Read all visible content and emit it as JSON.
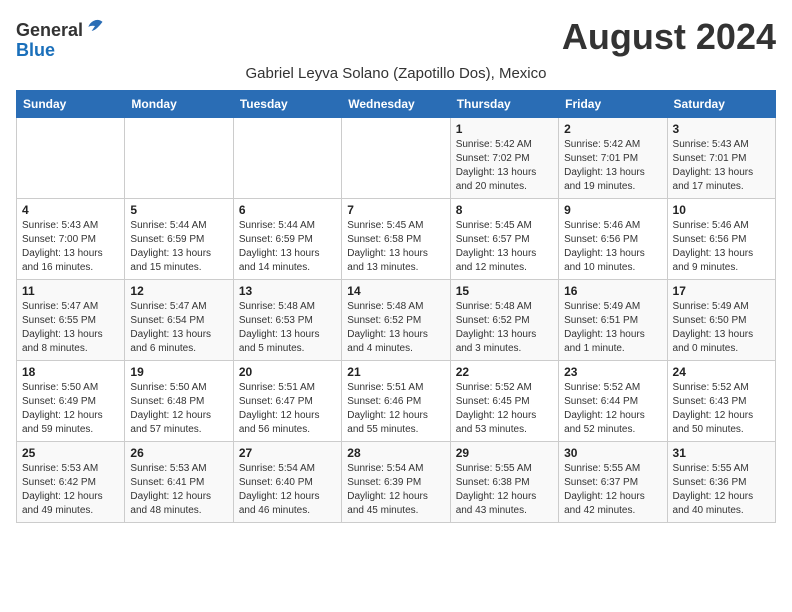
{
  "header": {
    "logo_general": "General",
    "logo_blue": "Blue",
    "month_title": "August 2024",
    "subtitle": "Gabriel Leyva Solano (Zapotillo Dos), Mexico"
  },
  "weekdays": [
    "Sunday",
    "Monday",
    "Tuesday",
    "Wednesday",
    "Thursday",
    "Friday",
    "Saturday"
  ],
  "weeks": [
    [
      {
        "day": "",
        "info": ""
      },
      {
        "day": "",
        "info": ""
      },
      {
        "day": "",
        "info": ""
      },
      {
        "day": "",
        "info": ""
      },
      {
        "day": "1",
        "info": "Sunrise: 5:42 AM\nSunset: 7:02 PM\nDaylight: 13 hours\nand 20 minutes."
      },
      {
        "day": "2",
        "info": "Sunrise: 5:42 AM\nSunset: 7:01 PM\nDaylight: 13 hours\nand 19 minutes."
      },
      {
        "day": "3",
        "info": "Sunrise: 5:43 AM\nSunset: 7:01 PM\nDaylight: 13 hours\nand 17 minutes."
      }
    ],
    [
      {
        "day": "4",
        "info": "Sunrise: 5:43 AM\nSunset: 7:00 PM\nDaylight: 13 hours\nand 16 minutes."
      },
      {
        "day": "5",
        "info": "Sunrise: 5:44 AM\nSunset: 6:59 PM\nDaylight: 13 hours\nand 15 minutes."
      },
      {
        "day": "6",
        "info": "Sunrise: 5:44 AM\nSunset: 6:59 PM\nDaylight: 13 hours\nand 14 minutes."
      },
      {
        "day": "7",
        "info": "Sunrise: 5:45 AM\nSunset: 6:58 PM\nDaylight: 13 hours\nand 13 minutes."
      },
      {
        "day": "8",
        "info": "Sunrise: 5:45 AM\nSunset: 6:57 PM\nDaylight: 13 hours\nand 12 minutes."
      },
      {
        "day": "9",
        "info": "Sunrise: 5:46 AM\nSunset: 6:56 PM\nDaylight: 13 hours\nand 10 minutes."
      },
      {
        "day": "10",
        "info": "Sunrise: 5:46 AM\nSunset: 6:56 PM\nDaylight: 13 hours\nand 9 minutes."
      }
    ],
    [
      {
        "day": "11",
        "info": "Sunrise: 5:47 AM\nSunset: 6:55 PM\nDaylight: 13 hours\nand 8 minutes."
      },
      {
        "day": "12",
        "info": "Sunrise: 5:47 AM\nSunset: 6:54 PM\nDaylight: 13 hours\nand 6 minutes."
      },
      {
        "day": "13",
        "info": "Sunrise: 5:48 AM\nSunset: 6:53 PM\nDaylight: 13 hours\nand 5 minutes."
      },
      {
        "day": "14",
        "info": "Sunrise: 5:48 AM\nSunset: 6:52 PM\nDaylight: 13 hours\nand 4 minutes."
      },
      {
        "day": "15",
        "info": "Sunrise: 5:48 AM\nSunset: 6:52 PM\nDaylight: 13 hours\nand 3 minutes."
      },
      {
        "day": "16",
        "info": "Sunrise: 5:49 AM\nSunset: 6:51 PM\nDaylight: 13 hours\nand 1 minute."
      },
      {
        "day": "17",
        "info": "Sunrise: 5:49 AM\nSunset: 6:50 PM\nDaylight: 13 hours\nand 0 minutes."
      }
    ],
    [
      {
        "day": "18",
        "info": "Sunrise: 5:50 AM\nSunset: 6:49 PM\nDaylight: 12 hours\nand 59 minutes."
      },
      {
        "day": "19",
        "info": "Sunrise: 5:50 AM\nSunset: 6:48 PM\nDaylight: 12 hours\nand 57 minutes."
      },
      {
        "day": "20",
        "info": "Sunrise: 5:51 AM\nSunset: 6:47 PM\nDaylight: 12 hours\nand 56 minutes."
      },
      {
        "day": "21",
        "info": "Sunrise: 5:51 AM\nSunset: 6:46 PM\nDaylight: 12 hours\nand 55 minutes."
      },
      {
        "day": "22",
        "info": "Sunrise: 5:52 AM\nSunset: 6:45 PM\nDaylight: 12 hours\nand 53 minutes."
      },
      {
        "day": "23",
        "info": "Sunrise: 5:52 AM\nSunset: 6:44 PM\nDaylight: 12 hours\nand 52 minutes."
      },
      {
        "day": "24",
        "info": "Sunrise: 5:52 AM\nSunset: 6:43 PM\nDaylight: 12 hours\nand 50 minutes."
      }
    ],
    [
      {
        "day": "25",
        "info": "Sunrise: 5:53 AM\nSunset: 6:42 PM\nDaylight: 12 hours\nand 49 minutes."
      },
      {
        "day": "26",
        "info": "Sunrise: 5:53 AM\nSunset: 6:41 PM\nDaylight: 12 hours\nand 48 minutes."
      },
      {
        "day": "27",
        "info": "Sunrise: 5:54 AM\nSunset: 6:40 PM\nDaylight: 12 hours\nand 46 minutes."
      },
      {
        "day": "28",
        "info": "Sunrise: 5:54 AM\nSunset: 6:39 PM\nDaylight: 12 hours\nand 45 minutes."
      },
      {
        "day": "29",
        "info": "Sunrise: 5:55 AM\nSunset: 6:38 PM\nDaylight: 12 hours\nand 43 minutes."
      },
      {
        "day": "30",
        "info": "Sunrise: 5:55 AM\nSunset: 6:37 PM\nDaylight: 12 hours\nand 42 minutes."
      },
      {
        "day": "31",
        "info": "Sunrise: 5:55 AM\nSunset: 6:36 PM\nDaylight: 12 hours\nand 40 minutes."
      }
    ]
  ]
}
